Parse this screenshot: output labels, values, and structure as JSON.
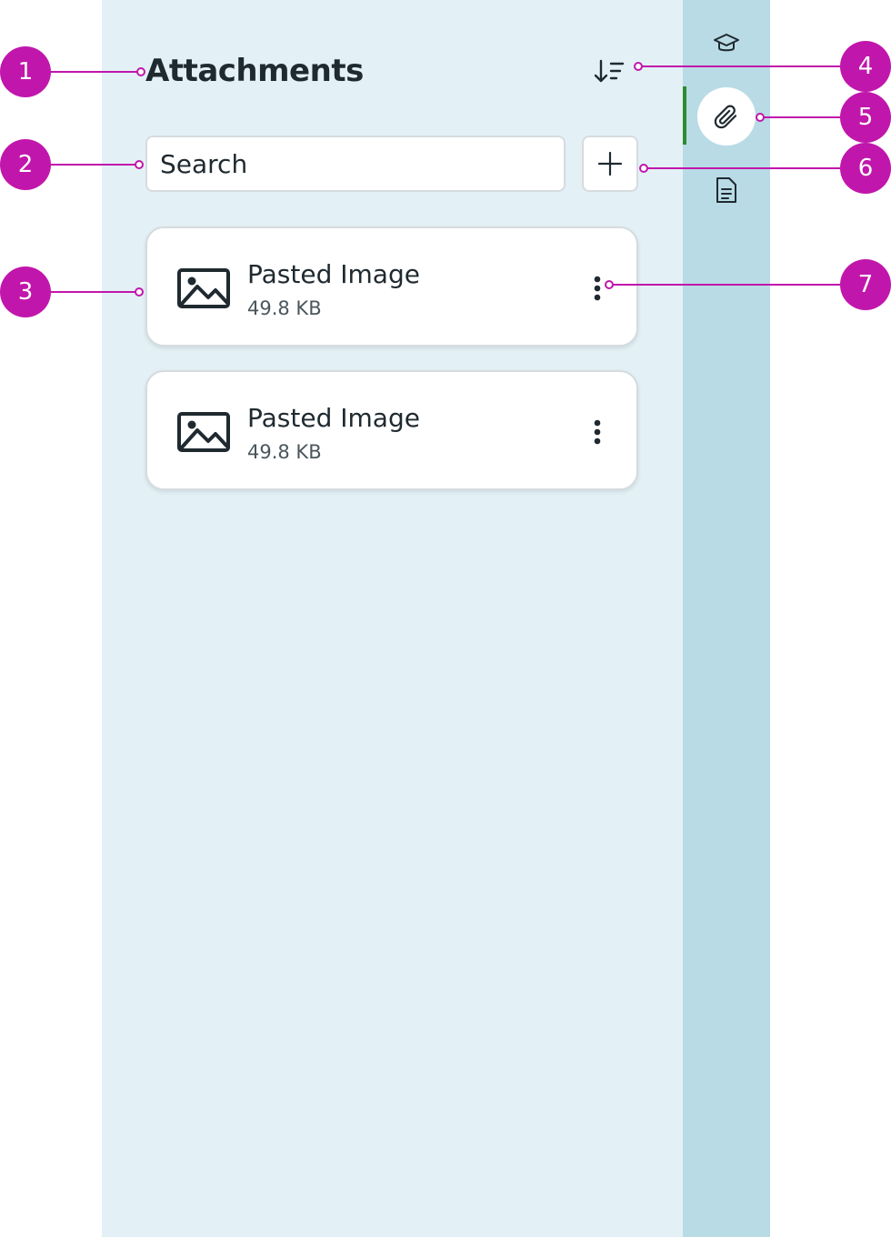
{
  "sidebar": {
    "title": "Attachments",
    "sort_icon": "sort-descending-icon",
    "search": {
      "placeholder": "Search",
      "value": ""
    },
    "add_icon": "plus-icon",
    "attachments": [
      {
        "name": "Pasted Image",
        "size": "49.8 KB",
        "icon": "image-icon",
        "menu_icon": "more-vertical-icon"
      },
      {
        "name": "Pasted Image",
        "size": "49.8 KB",
        "icon": "image-icon",
        "menu_icon": "more-vertical-icon"
      }
    ]
  },
  "rail": {
    "items": [
      {
        "icon": "graduation-cap-icon",
        "active": false
      },
      {
        "icon": "paperclip-icon",
        "active": true
      },
      {
        "icon": "document-icon",
        "active": false
      }
    ]
  },
  "callouts": [
    "1",
    "2",
    "3",
    "4",
    "5",
    "6",
    "7"
  ],
  "colors": {
    "panel_bg": "#e3f1f6",
    "rail_bg": "#b9dbe5",
    "active_indicator": "#2e8b2e",
    "callout": "#c116ab",
    "text": "#1f2a30"
  }
}
